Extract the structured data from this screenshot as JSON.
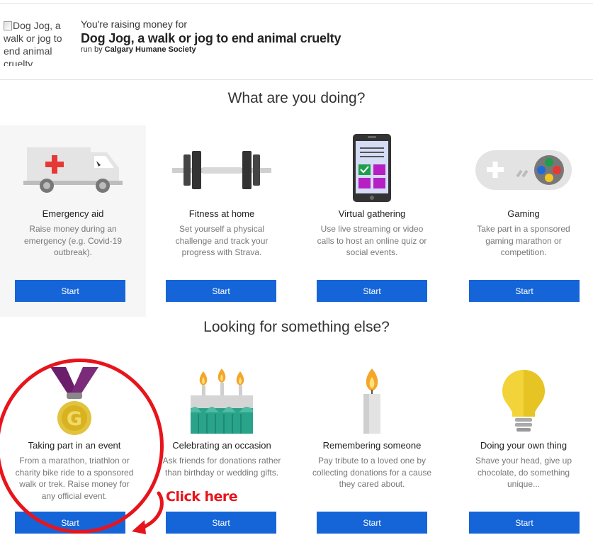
{
  "header": {
    "image_alt": "Dog Jog, a walk or jog to end animal cruelty",
    "raising_label": "You're raising money for",
    "campaign_title": "Dog Jog, a walk or jog to end animal cruelty",
    "run_by_prefix": "run by",
    "organisation": "Calgary Humane Society"
  },
  "section1": {
    "heading": "What are you doing?",
    "cards": [
      {
        "title": "Emergency aid",
        "description": "Raise money during an emergency (e.g. Covid-19 outbreak).",
        "button": "Start",
        "icon": "ambulance-icon"
      },
      {
        "title": "Fitness at home",
        "description": "Set yourself a physical challenge and track your progress with Strava.",
        "button": "Start",
        "icon": "dumbbell-icon"
      },
      {
        "title": "Virtual gathering",
        "description": "Use live streaming or video calls to host an online quiz or social events.",
        "button": "Start",
        "icon": "smartphone-icon"
      },
      {
        "title": "Gaming",
        "description": "Take part in a sponsored gaming marathon or competition.",
        "button": "Start",
        "icon": "gamepad-icon"
      }
    ]
  },
  "section2": {
    "heading": "Looking for something else?",
    "cards": [
      {
        "title": "Taking part in an event",
        "description": "From a marathon, triathlon or charity bike ride to a sponsored walk or trek. Raise money for any official event.",
        "button": "Start",
        "icon": "medal-icon"
      },
      {
        "title": "Celebrating an occasion",
        "description": "Ask friends for donations rather than birthday or wedding gifts.",
        "button": "Start",
        "icon": "birthday-cake-icon"
      },
      {
        "title": "Remembering someone",
        "description": "Pay tribute to a loved one by collecting donations for a cause they cared about.",
        "button": "Start",
        "icon": "candle-icon"
      },
      {
        "title": "Doing your own thing",
        "description": "Shave your head, give up chocolate, do something unique...",
        "button": "Start",
        "icon": "lightbulb-icon"
      }
    ]
  },
  "annotation": {
    "text": "Click here",
    "color": "#e8141c"
  },
  "colors": {
    "button": "#1565d8",
    "annotation": "#e8141c"
  }
}
